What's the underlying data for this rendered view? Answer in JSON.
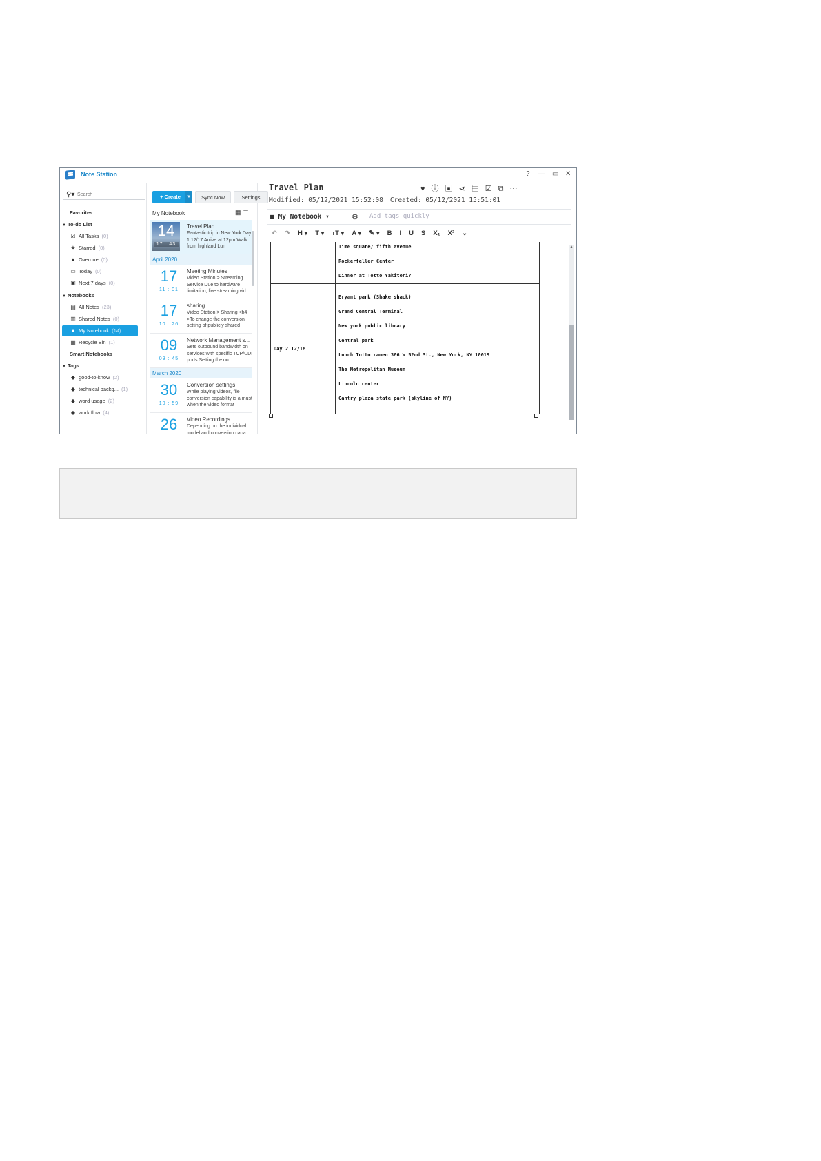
{
  "app": {
    "title": "Note Station",
    "controls": [
      "?",
      "—",
      "▭",
      "✕"
    ]
  },
  "sidebar": {
    "search_placeholder": "Search",
    "favorites": "Favorites",
    "todo": {
      "label": "To-do List",
      "items": [
        {
          "label": "All Tasks",
          "count": "(0)",
          "icon": "checkbox-icon"
        },
        {
          "label": "Starred",
          "count": "(0)",
          "icon": "star-icon"
        },
        {
          "label": "Overdue",
          "count": "(0)",
          "icon": "warning-icon"
        },
        {
          "label": "Today",
          "count": "(0)",
          "icon": "calendar-icon"
        },
        {
          "label": "Next 7 days",
          "count": "(0)",
          "icon": "calendar-week-icon"
        }
      ]
    },
    "notebooks": {
      "label": "Notebooks",
      "items": [
        {
          "label": "All Notes",
          "count": "(23)",
          "icon": "notes-icon"
        },
        {
          "label": "Shared Notes",
          "count": "(0)",
          "icon": "shared-notes-icon"
        },
        {
          "label": "My Notebook",
          "count": "(14)",
          "icon": "notebook-icon"
        },
        {
          "label": "Recycle Bin",
          "count": "(1)",
          "icon": "trash-icon"
        }
      ]
    },
    "smart_notebooks": "Smart Notebooks",
    "tags": {
      "label": "Tags",
      "items": [
        {
          "label": "good-to-know",
          "count": "(2)"
        },
        {
          "label": "technical backg...",
          "count": "(1)"
        },
        {
          "label": "word usage",
          "count": "(2)"
        },
        {
          "label": "work flow",
          "count": "(4)"
        }
      ]
    }
  },
  "list": {
    "create": "+ Create",
    "sync": "Sync Now",
    "settings": "Settings",
    "heading": "My Notebook",
    "groups": [
      "April 2020",
      "March 2020"
    ],
    "notes": [
      {
        "day": "14",
        "time": "17 : 43",
        "title": "Travel Plan",
        "snippet": "Fantastic trip in New York Day 1 12/17 Arrive at 12pm Walk from highland Lun"
      },
      {
        "day": "17",
        "time": "11 : 01",
        "title": "Meeting Minutes",
        "snippet": "Video Station > Streaming Service Due to hardware limitation, live streaming vid"
      },
      {
        "day": "17",
        "time": "10 : 26",
        "title": "sharing",
        "snippet": "Video Station > Sharing <h4 >To change the conversion setting of publicly shared"
      },
      {
        "day": "09",
        "time": "09 : 45",
        "title": "Network Management s...",
        "snippet": "Sets outbound bandwidth on services with specific TCP/UDP ports Setting the ou"
      },
      {
        "day": "30",
        "time": "10 : 59",
        "title": "Conversion settings",
        "snippet": "While playing videos, file conversion capability is a must when the video format"
      },
      {
        "day": "26",
        "time": "",
        "title": "Video Recordings",
        "snippet": "Depending on the individual model and conversion capa"
      }
    ]
  },
  "editor": {
    "title": "Travel Plan",
    "modified": "Modified: 05/12/2021 15:52:08",
    "created": "Created: 05/12/2021 15:51:01",
    "notebook": "My Notebook",
    "tags_placeholder": "Add tags quickly",
    "toolbar": [
      "↶",
      "↷",
      "H ▾",
      "T ▾",
      "ᴛT ▾",
      "A ▾",
      "✎ ▾",
      "B",
      "I",
      "U",
      "S",
      "X₁",
      "X²",
      "⌄"
    ],
    "table": {
      "row1_items": [
        "Time square/ fifth avenue",
        "Rockerfeller Center",
        "Dinner at Totto Yakitori?"
      ],
      "row2_label": "Day 2 12/18",
      "row2_items": [
        "Bryant park (Shake shack)",
        "Grand Central Terminal",
        "New york public library",
        "Central park",
        "Lunch Totto ramen 366 W 52nd St., New York, NY 10019",
        "The Metropolitan Museum",
        "Lincoln center",
        "Gantry plaza state park (skyline of NY)"
      ]
    }
  },
  "colors": {
    "accent": "#1aa0e1",
    "selected": "#1aa0e1"
  }
}
